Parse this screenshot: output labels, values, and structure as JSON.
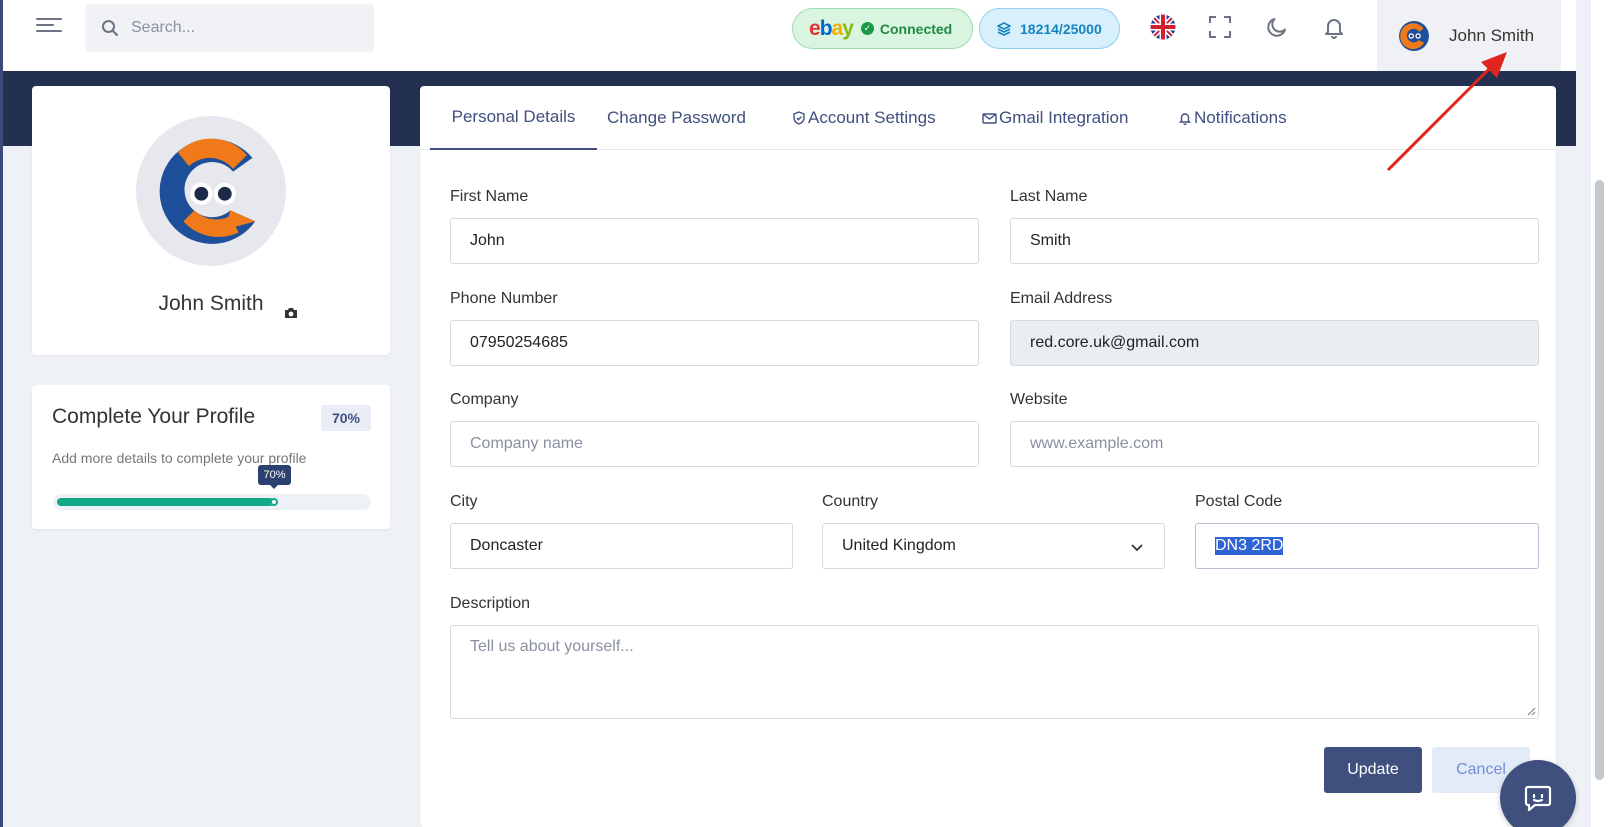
{
  "topbar": {
    "search_placeholder": "Search...",
    "ebay": {
      "logo": [
        "e",
        "b",
        "a",
        "y"
      ],
      "status": "Connected"
    },
    "credits": "18214/25000",
    "user_name": "John Smith"
  },
  "profile": {
    "name": "John Smith"
  },
  "completion": {
    "title": "Complete Your Profile",
    "percent_label": "70%",
    "percent": 70,
    "subtitle": "Add more details to complete your profile",
    "tooltip": "70%"
  },
  "tabs": [
    {
      "label": "Personal Details",
      "icon": ""
    },
    {
      "label": "Change Password",
      "icon": ""
    },
    {
      "label": "Account Settings",
      "icon": "shield-icon"
    },
    {
      "label": "Gmail Integration",
      "icon": "mail-icon"
    },
    {
      "label": "Notifications",
      "icon": "bell-icon"
    }
  ],
  "form": {
    "first_name": {
      "label": "First Name",
      "value": "John"
    },
    "last_name": {
      "label": "Last Name",
      "value": "Smith"
    },
    "phone": {
      "label": "Phone Number",
      "value": "07950254685"
    },
    "email": {
      "label": "Email Address",
      "value": "red.core.uk@gmail.com"
    },
    "company": {
      "label": "Company",
      "placeholder": "Company name"
    },
    "website": {
      "label": "Website",
      "placeholder": "www.example.com"
    },
    "city": {
      "label": "City",
      "value": "Doncaster"
    },
    "country": {
      "label": "Country",
      "value": "United Kingdom"
    },
    "postal": {
      "label": "Postal Code",
      "value": "DN3 2RD"
    },
    "description": {
      "label": "Description",
      "placeholder": "Tell us about yourself..."
    },
    "update_label": "Update",
    "cancel_label": "Cancel"
  },
  "colors": {
    "primary": "#3f4f7e",
    "banner": "#243050",
    "progress": "#13a889",
    "annotation": "#e0241f"
  }
}
